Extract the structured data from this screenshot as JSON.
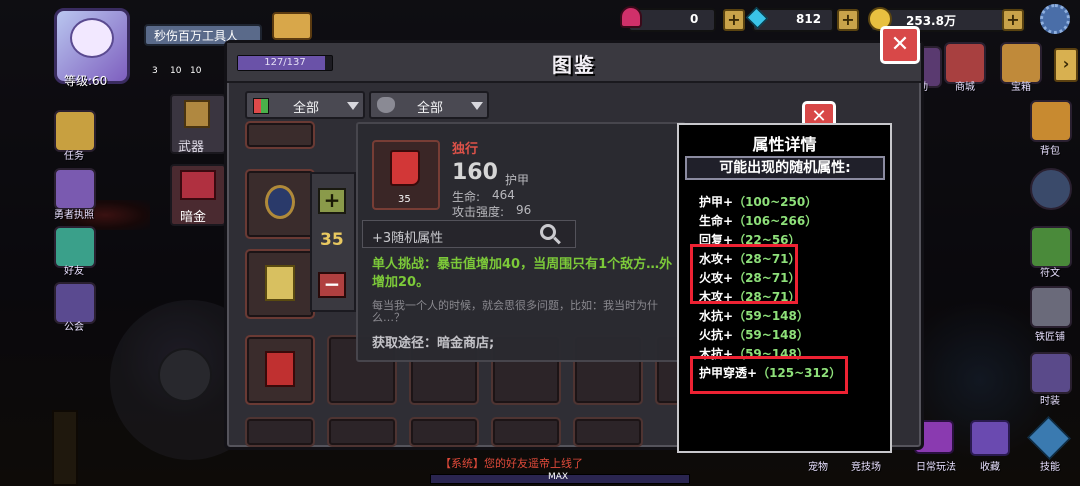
{
  "player": {
    "name": "秒伤百万工具人",
    "level_label": "等级:60",
    "mini_stats": [
      "3",
      "10",
      "10"
    ]
  },
  "currency": {
    "gems": "0",
    "diamonds": "812",
    "gold": "253.8万"
  },
  "left_menu": [
    {
      "label": "任务",
      "icon": "quest-icon"
    },
    {
      "label": "勇者执照",
      "icon": "license-icon"
    },
    {
      "label": "好友",
      "icon": "friend-icon"
    },
    {
      "label": "公会",
      "icon": "guild-icon"
    }
  ],
  "category_tabs": [
    {
      "label": "武器"
    },
    {
      "label": "暗金"
    }
  ],
  "right_menu": [
    {
      "label": "活动"
    },
    {
      "label": "商城"
    },
    {
      "label": "宝箱"
    },
    {
      "label": "背包"
    },
    {
      "label": "符文"
    },
    {
      "label": "铁匠铺"
    },
    {
      "label": "时装"
    }
  ],
  "bottom_menu": [
    {
      "label": "宠物"
    },
    {
      "label": "竞技场"
    },
    {
      "label": "日常玩法"
    },
    {
      "label": "收藏"
    },
    {
      "label": "技能"
    }
  ],
  "codex": {
    "title": "图鉴",
    "progress_text": "127/137",
    "progress_fraction": 0.927,
    "filter_1": "全部",
    "filter_2": "全部"
  },
  "stepper": {
    "value": "35",
    "plus": "+",
    "minus": "−"
  },
  "item": {
    "name": "独行",
    "armor": "160",
    "armor_label": "护甲",
    "count": "35",
    "hp_label": "生命:",
    "hp_value": "464",
    "atk_label": "攻击强度:",
    "atk_value": "96",
    "search_text": "+3随机属性",
    "desc_green": "单人挑战：暴击值增加40，当周围只有1个敌方…外增加20。",
    "desc_gray": "每当我一个人的时候，就会思很多问题，比如：我当时为什么…？",
    "source": "获取途径：暗金商店;"
  },
  "attributes": {
    "title": "属性详情",
    "subtitle": "可能出现的随机属性:",
    "rows": [
      {
        "name": "护甲+",
        "range": "（100~250）"
      },
      {
        "name": "生命+",
        "range": "（106~266）"
      },
      {
        "name": "回复+",
        "range": "（22~56）"
      },
      {
        "name": "水攻+",
        "range": "（28~71）"
      },
      {
        "name": "火攻+",
        "range": "（28~71）"
      },
      {
        "name": "木攻+",
        "range": "（28~71）"
      },
      {
        "name": "水抗+",
        "range": "（59~148）"
      },
      {
        "name": "火抗+",
        "range": "（59~148）"
      },
      {
        "name": "木抗+",
        "range": "（59~148）"
      },
      {
        "name": "护甲穿透+",
        "range": "（125~312）"
      }
    ],
    "highlight_color": "#ee2233"
  },
  "close_label": "✕",
  "system_message": "【系统】您的好友遥帝上线了",
  "exp_bar_label": "MAX",
  "colors": {
    "accent_purple": "#6a52a8",
    "rarity_red": "#e4544a",
    "effect_green": "#7fcf3a",
    "range_green": "#8ee07a"
  }
}
